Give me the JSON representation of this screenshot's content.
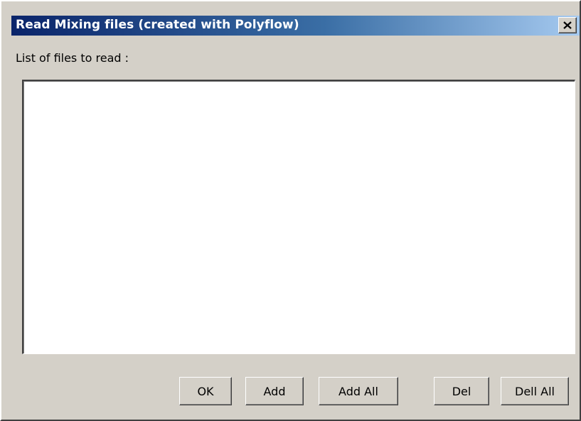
{
  "window": {
    "title": "Read Mixing files (created with Polyflow)",
    "close_icon": "close-icon"
  },
  "list": {
    "label": "List of files to read :",
    "items": []
  },
  "buttons": {
    "ok": "OK",
    "add": "Add",
    "add_all": "Add All",
    "del": "Del",
    "dell_all": "Dell All"
  },
  "colors": {
    "titlebar_start": "#0a246a",
    "titlebar_end": "#a6caf0",
    "dialog_bg": "#d4d0c8",
    "list_bg": "#ffffff"
  }
}
